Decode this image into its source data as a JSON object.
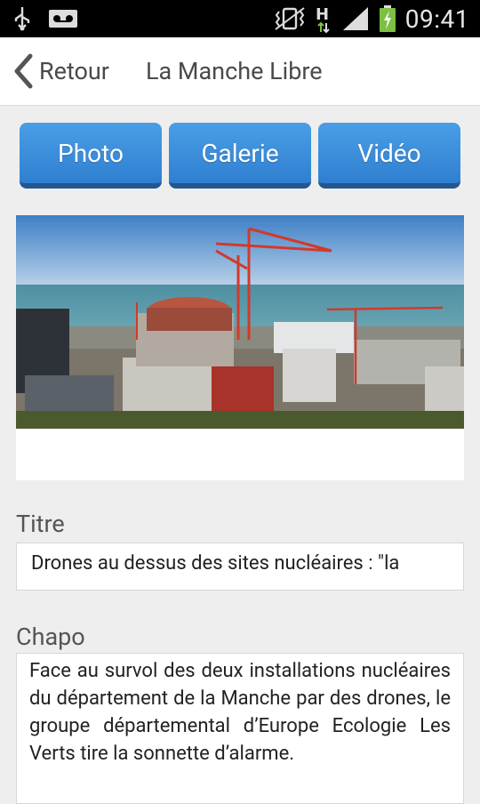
{
  "status_bar": {
    "time": "09:41",
    "icons": [
      "usb-icon",
      "voicemail-icon",
      "vibrate-icon",
      "network-h-icon",
      "signal-icon",
      "battery-charging-icon"
    ]
  },
  "action_bar": {
    "back_label": "Retour",
    "title": "La Manche Libre"
  },
  "media_buttons": {
    "photo": "Photo",
    "gallery": "Galerie",
    "video": "Vidéo"
  },
  "colors": {
    "button_blue": "#2f7fd0",
    "button_shadow": "#24578f",
    "background": "#eeeeee"
  },
  "form": {
    "title_label": "Titre",
    "title_value": "Drones au dessus des sites nucléaires : \"la",
    "chapo_label": "Chapo",
    "chapo_value": "Face au survol des deux installations nucléaires du département de la Manche par des drones, le groupe départemental d’Europe Ecologie Les Verts tire la sonnette d’alarme."
  }
}
